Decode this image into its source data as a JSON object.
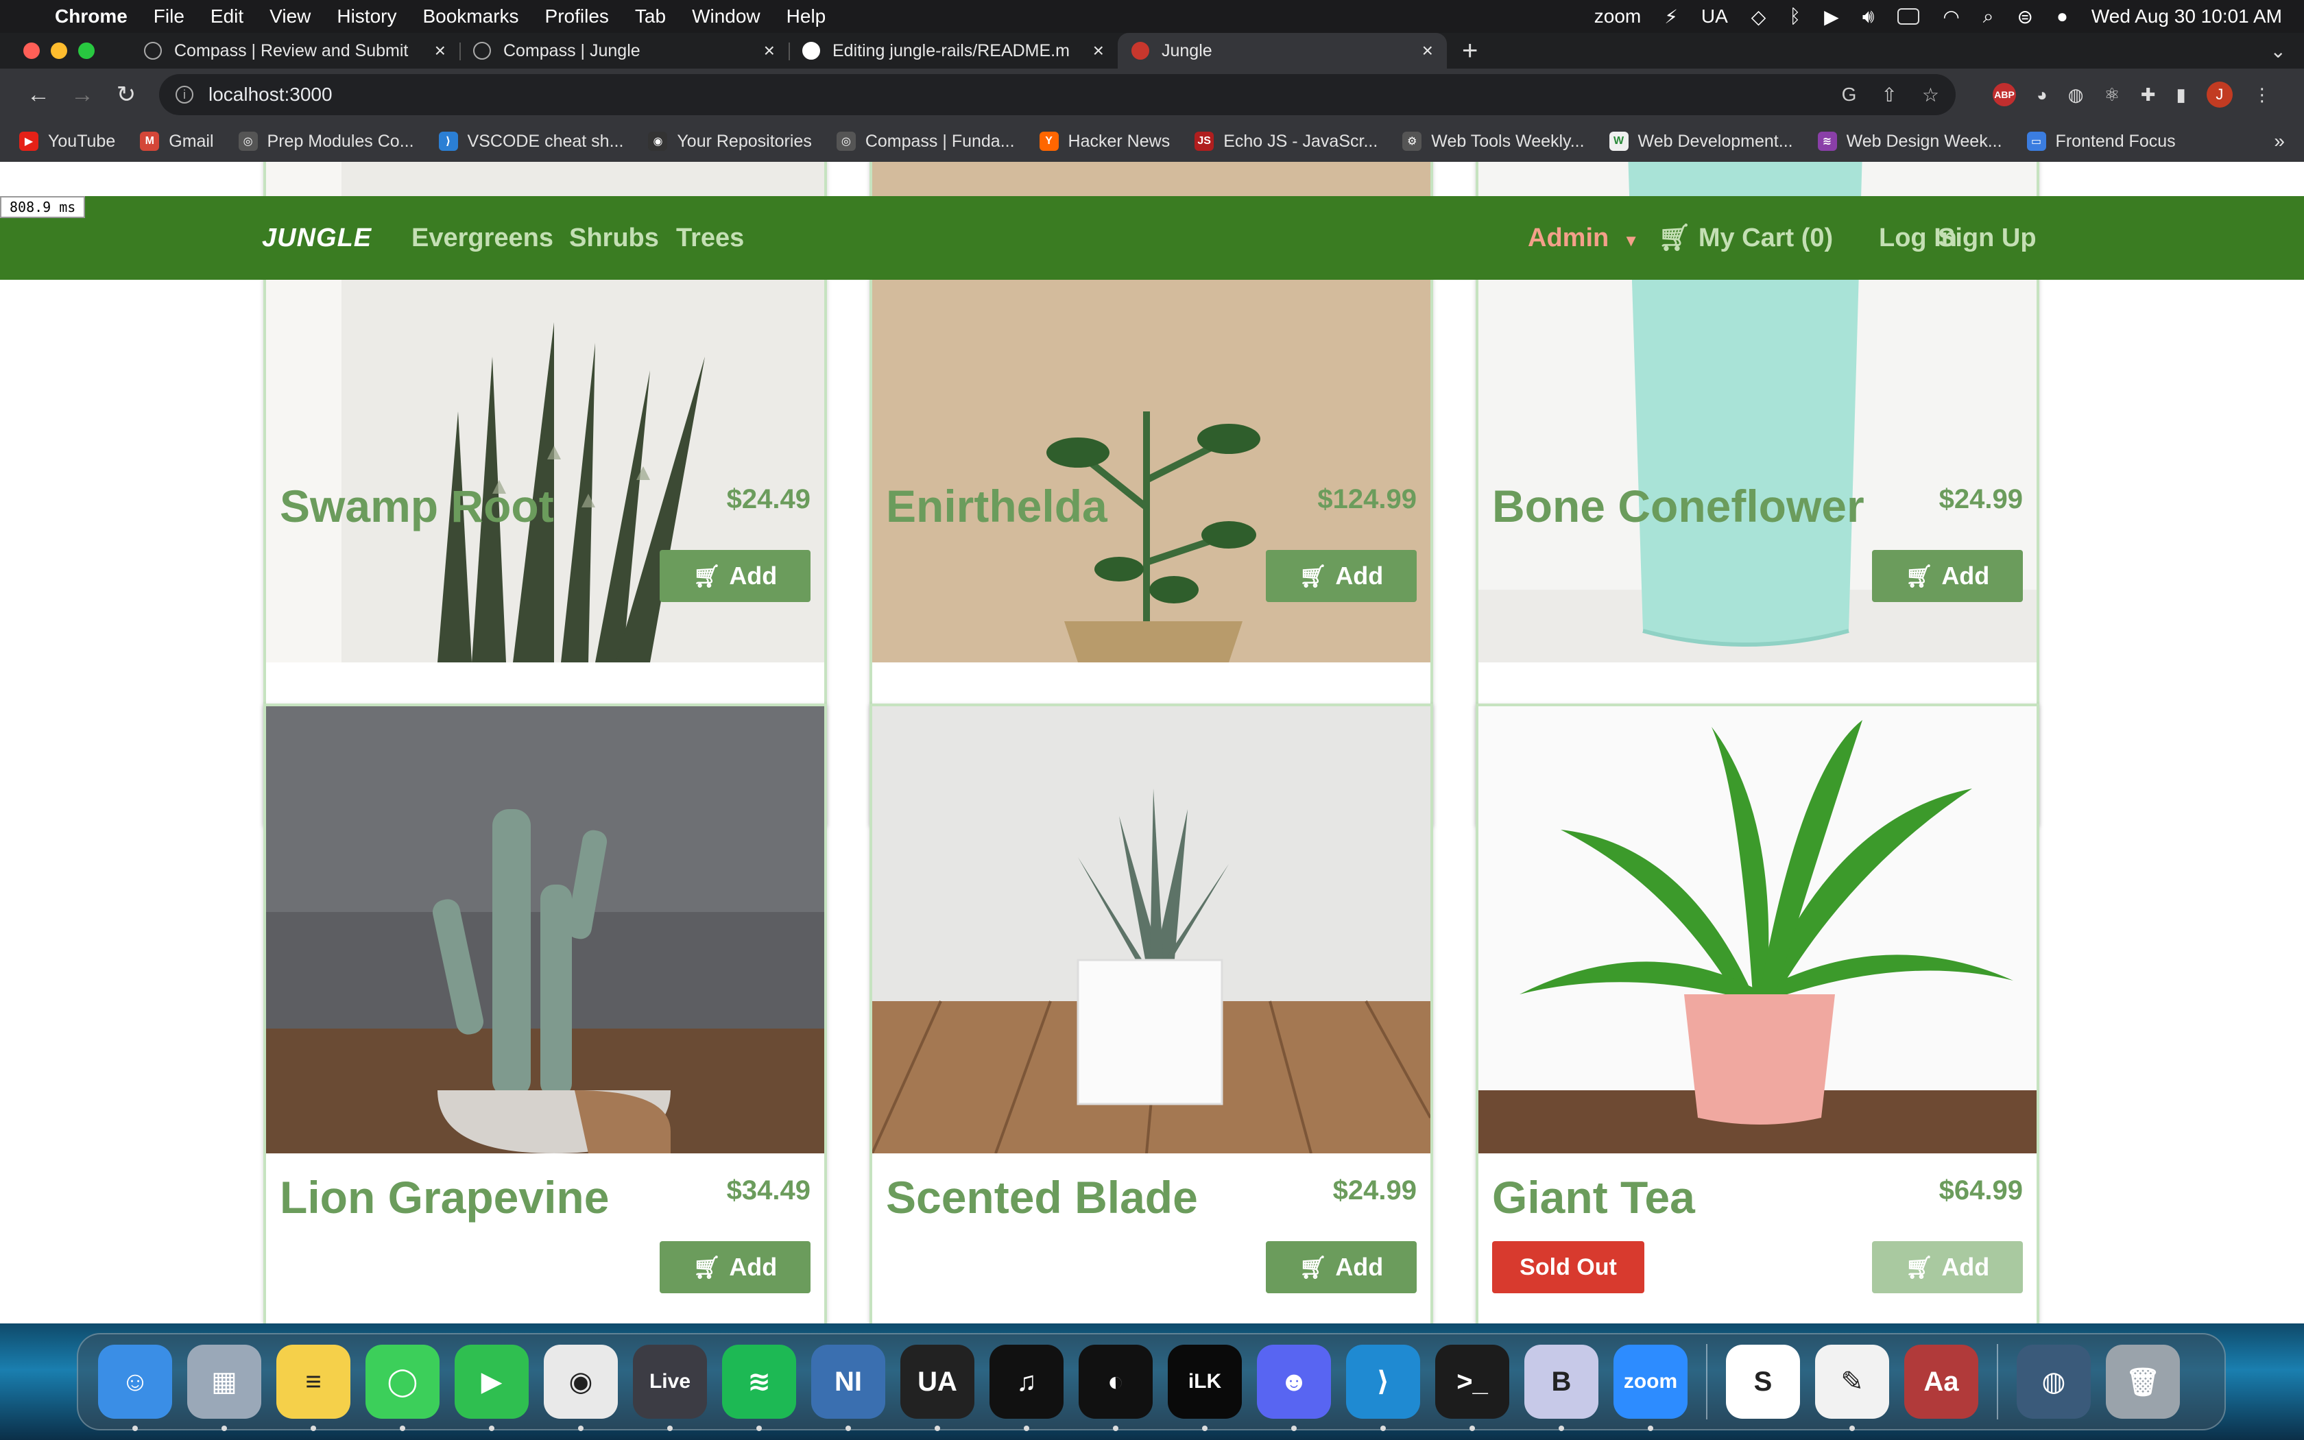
{
  "menubar": {
    "app": "Chrome",
    "items": [
      "File",
      "Edit",
      "View",
      "History",
      "Bookmarks",
      "Profiles",
      "Tab",
      "Window",
      "Help"
    ],
    "tray": [
      "zoom",
      "UA"
    ],
    "clock": "Wed Aug 30  10:01 AM"
  },
  "tabs": [
    {
      "title": "Compass | Review and Submit",
      "active": false
    },
    {
      "title": "Compass | Jungle",
      "active": false
    },
    {
      "title": "Editing jungle-rails/README.m",
      "active": false
    },
    {
      "title": "Jungle",
      "active": true
    }
  ],
  "toolbar": {
    "url": "localhost:3000",
    "profile_initial": "J",
    "abp": "ABP"
  },
  "bookmarks": [
    {
      "label": "YouTube",
      "color": "#e62117",
      "glyph": "▶"
    },
    {
      "label": "Gmail",
      "color": "#d44638",
      "glyph": "M"
    },
    {
      "label": "Prep Modules Co...",
      "color": "#555555",
      "glyph": "◎"
    },
    {
      "label": "VSCODE cheat sh...",
      "color": "#2b7fd4",
      "glyph": "⟩"
    },
    {
      "label": "Your Repositories",
      "color": "#333333",
      "glyph": "◉"
    },
    {
      "label": "Compass | Funda...",
      "color": "#555555",
      "glyph": "◎"
    },
    {
      "label": "Hacker News",
      "color": "#ff6600",
      "glyph": "Y"
    },
    {
      "label": "Echo JS - JavaScr...",
      "color": "#b01e1e",
      "glyph": "JS"
    },
    {
      "label": "Web Tools Weekly...",
      "color": "#555555",
      "glyph": "⚙"
    },
    {
      "label": "Web Development...",
      "color": "#f0f0f0",
      "glyph": "W"
    },
    {
      "label": "Web Design Week...",
      "color": "#8a3fa8",
      "glyph": "≋"
    },
    {
      "label": "Frontend Focus",
      "color": "#3b7de0",
      "glyph": "▭"
    }
  ],
  "timing": "808.9 ms",
  "site_nav": {
    "brand": "JUNGLE",
    "links": [
      "Evergreens",
      "Shrubs",
      "Trees"
    ],
    "admin": "Admin",
    "cart": "My Cart (0)",
    "login": "Log In",
    "signup": "Sign Up"
  },
  "products": [
    {
      "name": "Swamp Root",
      "price": "$24.49",
      "add": "Add",
      "sold_out": false
    },
    {
      "name": "Enirthelda",
      "price": "$124.99",
      "add": "Add",
      "sold_out": false
    },
    {
      "name": "Bone Coneflower",
      "price": "$24.99",
      "add": "Add",
      "sold_out": false
    },
    {
      "name": "Lion Grapevine",
      "price": "$34.49",
      "add": "Add",
      "sold_out": false
    },
    {
      "name": "Scented Blade",
      "price": "$24.99",
      "add": "Add",
      "sold_out": false
    },
    {
      "name": "Giant Tea",
      "price": "$64.99",
      "add": "Add",
      "sold_out": true,
      "sold_out_label": "Sold Out"
    }
  ],
  "dock": [
    {
      "name": "Finder",
      "color": "#3a8ee6",
      "glyph": "☺"
    },
    {
      "name": "Launchpad",
      "color": "#9aa8b8",
      "glyph": "▦"
    },
    {
      "name": "Notes",
      "color": "#f5d04a",
      "glyph": "≡"
    },
    {
      "name": "Messages",
      "color": "#3ccf5a",
      "glyph": "◯"
    },
    {
      "name": "FaceTime",
      "color": "#2fbf50",
      "glyph": "▶"
    },
    {
      "name": "Chrome",
      "color": "#e9e9e9",
      "glyph": "◉"
    },
    {
      "name": "Live",
      "color": "#3c3c44",
      "glyph": "Live"
    },
    {
      "name": "Spotify",
      "color": "#1db954",
      "glyph": "≋"
    },
    {
      "name": "NI",
      "color": "#3a6fb0",
      "glyph": "NI"
    },
    {
      "name": "UA",
      "color": "#222222",
      "glyph": "UA"
    },
    {
      "name": "UA Connect",
      "color": "#111111",
      "glyph": "♫"
    },
    {
      "name": "UA Console",
      "color": "#111111",
      "glyph": "◐"
    },
    {
      "name": "iLok",
      "color": "#0a0a0a",
      "glyph": "iLK"
    },
    {
      "name": "Discord",
      "color": "#5865f2",
      "glyph": "☻"
    },
    {
      "name": "VS Code",
      "color": "#1f8ad2",
      "glyph": "⟩"
    },
    {
      "name": "Terminal",
      "color": "#1c1c1c",
      "glyph": ">_"
    },
    {
      "name": "BBEdit",
      "color": "#c7c9e8",
      "glyph": "B"
    },
    {
      "name": "Zoom",
      "color": "#2d8cff",
      "glyph": "zoom"
    },
    {
      "name": "Setapp",
      "color": "#ffffff",
      "glyph": "S"
    },
    {
      "name": "TextEdit",
      "color": "#f2f2f2",
      "glyph": "✎"
    },
    {
      "name": "Dictionary",
      "color": "#b13a3a",
      "glyph": "Aa"
    },
    {
      "name": "Downloads",
      "color": "#3a5a7a",
      "glyph": "◍"
    },
    {
      "name": "Trash",
      "color": "#9aa3ab",
      "glyph": "🗑"
    }
  ]
}
